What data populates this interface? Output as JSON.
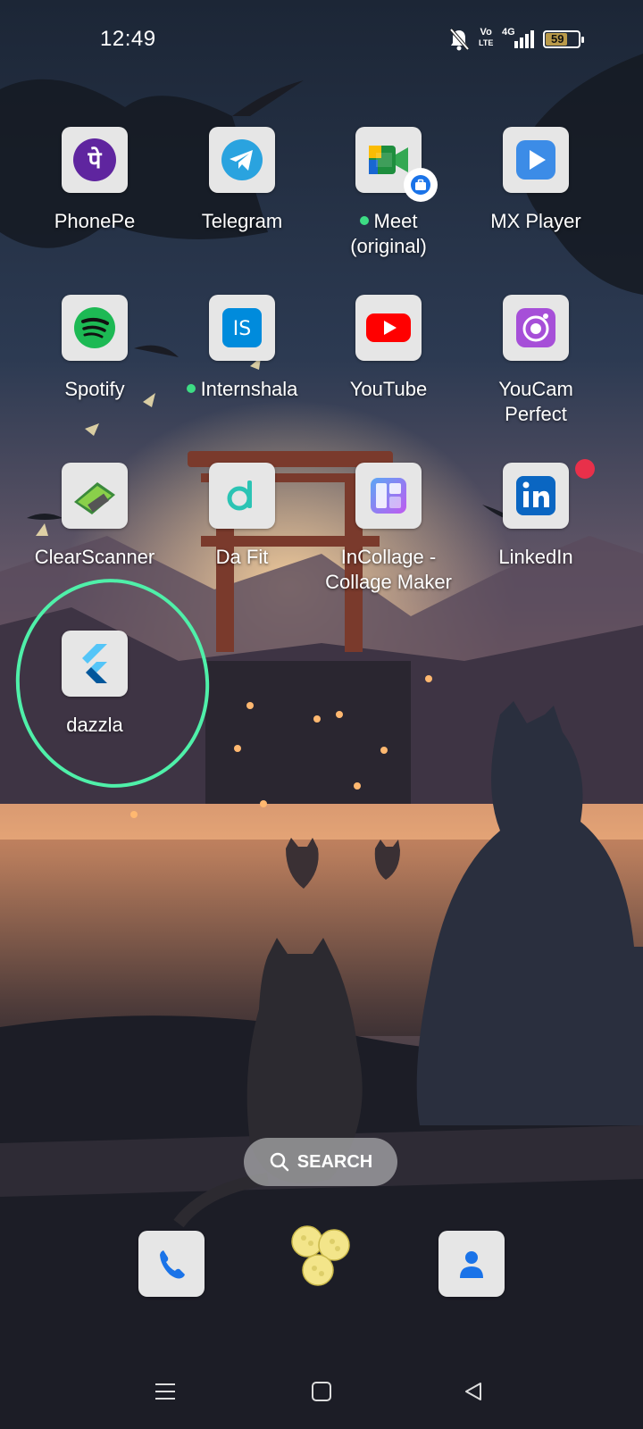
{
  "status_bar": {
    "time": "12:49",
    "network_label_top": "Vo",
    "network_label_bottom": "LTE",
    "signal_label": "4G",
    "battery_level": "59"
  },
  "apps": [
    {
      "label": "PhonePe",
      "icon": "phonepe-icon"
    },
    {
      "label": "Telegram",
      "icon": "telegram-icon"
    },
    {
      "label": "Meet\n(original)",
      "label_line1": "Meet",
      "label_line2": "(original)",
      "icon": "meet-icon",
      "new_dot": true,
      "work_badge": true
    },
    {
      "label": "MX Player",
      "icon": "mx-player-icon"
    },
    {
      "label": "Spotify",
      "icon": "spotify-icon"
    },
    {
      "label": "Internshala",
      "icon": "internshala-icon",
      "new_dot": true
    },
    {
      "label": "YouTube",
      "icon": "youtube-icon"
    },
    {
      "label_line1": "YouCam",
      "label_line2": "Perfect",
      "icon": "youcam-icon"
    },
    {
      "label": "ClearScanner",
      "icon": "clearscanner-icon"
    },
    {
      "label": "Da Fit",
      "icon": "dafit-icon"
    },
    {
      "label_line1": "InCollage -",
      "label_line2": "Collage Maker",
      "icon": "incollage-icon"
    },
    {
      "label": "LinkedIn",
      "icon": "linkedin-icon",
      "notification": true
    },
    {
      "label": "dazzla",
      "icon": "flutter-icon",
      "highlighted": true
    }
  ],
  "search": {
    "label": "SEARCH"
  },
  "dock": [
    {
      "name": "phone-app",
      "icon": "phone-icon"
    },
    {
      "name": "gallery-app",
      "icon": "gallery-icon"
    },
    {
      "name": "contacts-app",
      "icon": "contacts-icon"
    }
  ],
  "nav": [
    "menu-icon",
    "home-icon",
    "back-icon"
  ],
  "colors": {
    "highlight_ring": "#4ff0a9",
    "notification_dot": "#e8304a",
    "new_app_dot": "#3ddc84"
  }
}
